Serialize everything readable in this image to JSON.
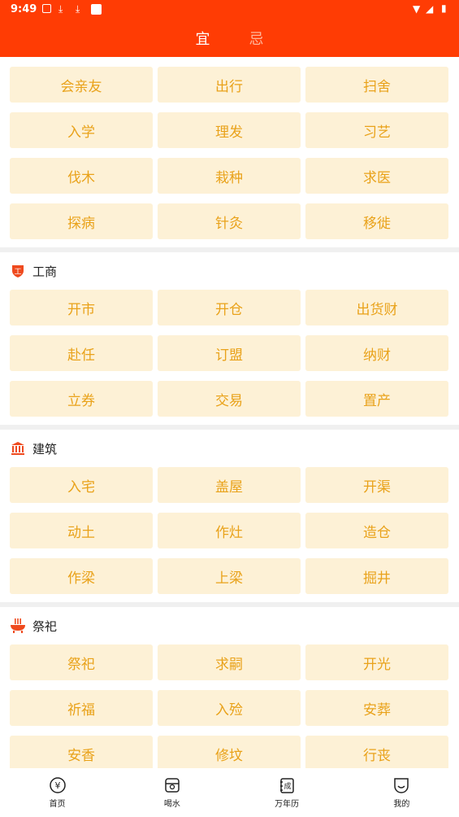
{
  "status_bar": {
    "time": "9:49"
  },
  "header": {
    "tabs": [
      {
        "label": "宜",
        "active": true
      },
      {
        "label": "忌",
        "active": false
      }
    ]
  },
  "colors": {
    "header_bg": "#ff3c04",
    "cell_bg": "#fdf1d6",
    "cell_text": "#e9a21a",
    "section_icon": "#ef4a1e"
  },
  "top_items": [
    "会亲友",
    "出行",
    "扫舍",
    "入学",
    "理发",
    "习艺",
    "伐木",
    "栽种",
    "求医",
    "探病",
    "针灸",
    "移徙"
  ],
  "sections": [
    {
      "icon": "shield-gong-icon",
      "icon_char": "工",
      "title": "工商",
      "items": [
        "开市",
        "开仓",
        "出货财",
        "赴任",
        "订盟",
        "纳财",
        "立券",
        "交易",
        "置产"
      ]
    },
    {
      "icon": "building-icon",
      "title": "建筑",
      "items": [
        "入宅",
        "盖屋",
        "开渠",
        "动土",
        "作灶",
        "造仓",
        "作梁",
        "上梁",
        "掘井"
      ]
    },
    {
      "icon": "incense-burner-icon",
      "title": "祭祀",
      "items": [
        "祭祀",
        "求嗣",
        "开光",
        "祈福",
        "入殓",
        "安葬",
        "安香",
        "修坟",
        "行丧"
      ]
    }
  ],
  "bottom_nav": [
    {
      "label": "首页",
      "icon": "yen-circle-icon"
    },
    {
      "label": "喝水",
      "icon": "water-cup-icon"
    },
    {
      "label": "万年历",
      "icon": "calendar-book-icon",
      "icon_char": "成"
    },
    {
      "label": "我的",
      "icon": "face-icon"
    }
  ]
}
